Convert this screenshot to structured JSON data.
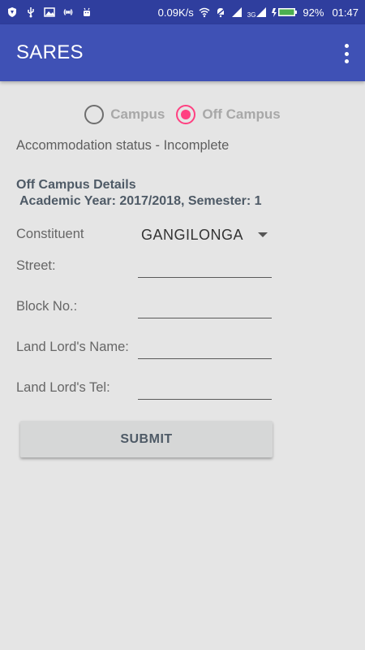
{
  "statusbar": {
    "speed": "0.09K/s",
    "network": "3G",
    "battery": "92%",
    "time": "01:47",
    "icons": [
      "shield-icon",
      "usb-icon",
      "image-icon",
      "hotspot-icon",
      "android-icon",
      "wifi-icon",
      "alarm-off-icon",
      "signal-icon",
      "signal-icon",
      "battery-icon"
    ]
  },
  "appbar": {
    "title": "SARES"
  },
  "radio": {
    "option_campus": "Campus",
    "option_off_campus": "Off Campus",
    "selected": "Off Campus"
  },
  "status_text": "Accommodation status - Incomplete",
  "details": {
    "title": "Off Campus Details",
    "subtitle": "Academic Year: 2017/2018, Semester: 1"
  },
  "form": {
    "constituent_label": "Constituent",
    "constituent_value": "GANGILONGA",
    "street_label": "Street:",
    "block_label": "Block No.:",
    "landlord_name_label": "Land Lord's Name:",
    "landlord_tel_label": "Land Lord's Tel:",
    "street_value": "",
    "block_value": "",
    "landlord_name_value": "",
    "landlord_tel_value": ""
  },
  "submit_label": "SUBMIT",
  "colors": {
    "primary": "#3f51b5",
    "primary_dark": "#2f3e9e",
    "accent": "#ff4081"
  }
}
